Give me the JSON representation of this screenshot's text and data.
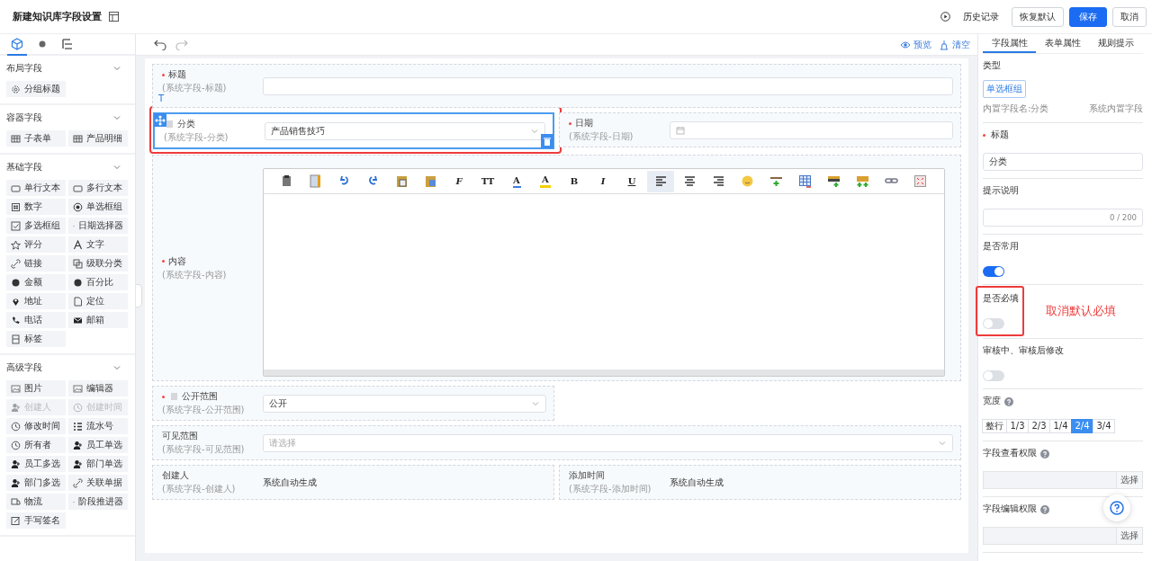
{
  "header": {
    "title": "新建知识库字段设置",
    "actions": [
      {
        "kind": "link",
        "label": "历史记录"
      },
      {
        "kind": "default",
        "label": "恢复默认"
      },
      {
        "kind": "primary",
        "label": "保存"
      },
      {
        "kind": "default",
        "label": "取消"
      }
    ]
  },
  "sidebar": {
    "tabs": [
      {
        "selected": true
      },
      {
        "selected": false
      },
      {
        "selected": false
      }
    ],
    "sections": [
      {
        "title": "布局字段",
        "expanded": true,
        "items": [
          {
            "label": "分组标题",
            "disabled": false
          }
        ]
      },
      {
        "title": "容器字段",
        "expanded": true,
        "items": [
          {
            "label": "子表单",
            "disabled": false
          },
          {
            "label": "产品明细",
            "disabled": false
          }
        ]
      },
      {
        "title": "基础字段",
        "expanded": true,
        "items": [
          {
            "label": "单行文本",
            "disabled": false
          },
          {
            "label": "多行文本",
            "disabled": false
          },
          {
            "label": "数字",
            "disabled": false
          },
          {
            "label": "单选框组",
            "disabled": false
          },
          {
            "label": "多选框组",
            "disabled": false
          },
          {
            "label": "日期选择器",
            "disabled": false
          },
          {
            "label": "评分",
            "disabled": false
          },
          {
            "label": "文字",
            "disabled": false
          },
          {
            "label": "链接",
            "disabled": false
          },
          {
            "label": "级联分类",
            "disabled": false
          },
          {
            "label": "金额",
            "disabled": false
          },
          {
            "label": "百分比",
            "disabled": false
          },
          {
            "label": "地址",
            "disabled": false
          },
          {
            "label": "定位",
            "disabled": false
          },
          {
            "label": "电话",
            "disabled": false
          },
          {
            "label": "邮箱",
            "disabled": false
          },
          {
            "label": "标签",
            "disabled": false
          }
        ]
      },
      {
        "title": "高级字段",
        "expanded": true,
        "items": [
          {
            "label": "图片",
            "disabled": false
          },
          {
            "label": "编辑器",
            "disabled": false
          },
          {
            "label": "创建人",
            "disabled": true
          },
          {
            "label": "创建时间",
            "disabled": true
          },
          {
            "label": "修改时间",
            "disabled": false
          },
          {
            "label": "流水号",
            "disabled": false
          },
          {
            "label": "所有者",
            "disabled": false
          },
          {
            "label": "员工单选",
            "disabled": false
          },
          {
            "label": "员工多选",
            "disabled": false
          },
          {
            "label": "部门单选",
            "disabled": false
          },
          {
            "label": "部门多选",
            "disabled": false
          },
          {
            "label": "关联单据",
            "disabled": false
          },
          {
            "label": "物流",
            "disabled": false
          },
          {
            "label": "阶段推进器",
            "disabled": false
          },
          {
            "label": "手写签名",
            "disabled": false
          }
        ]
      }
    ]
  },
  "canvas": {
    "actions": [
      {
        "label": "预览"
      },
      {
        "label": "清空"
      }
    ],
    "fields": [
      {
        "kind": "input",
        "label": "标题",
        "sublabel": "(系统字段-标题)",
        "required": true,
        "full": true,
        "locked": false,
        "selected": false,
        "annotated": false,
        "marker": "T"
      },
      {
        "kind": "select",
        "label": "分类",
        "sublabel": "(系统字段-分类)",
        "required": false,
        "full": false,
        "locked": true,
        "selected": true,
        "annotated": true,
        "value": "产品销售技巧"
      },
      {
        "kind": "date",
        "label": "日期",
        "sublabel": "(系统字段-日期)",
        "required": true,
        "full": false,
        "locked": false,
        "selected": false,
        "annotated": false
      },
      {
        "kind": "editor",
        "label": "内容",
        "sublabel": "(系统字段-内容)",
        "required": true,
        "full": true,
        "locked": false,
        "selected": false,
        "annotated": false,
        "toolbar": [
          {
            "kind": "icon",
            "selected": false
          },
          {
            "kind": "icon",
            "selected": false
          },
          {
            "kind": "icon",
            "selected": false
          },
          {
            "kind": "icon",
            "selected": false
          },
          {
            "kind": "icon",
            "selected": false
          },
          {
            "kind": "icon",
            "selected": false
          },
          {
            "kind": "glyph",
            "label": "F",
            "selected": false
          },
          {
            "kind": "glyph",
            "label": "TT",
            "selected": false
          },
          {
            "kind": "color",
            "label": "A",
            "color": "#3b7ddd",
            "selected": false
          },
          {
            "kind": "highlight",
            "label": "A",
            "color": "#f5d000",
            "selected": false
          },
          {
            "kind": "glyph",
            "label": "B",
            "selected": false
          },
          {
            "kind": "glyph",
            "label": "I",
            "selected": false
          },
          {
            "kind": "glyph",
            "label": "U",
            "selected": false
          },
          {
            "kind": "icon",
            "selected": true
          },
          {
            "kind": "icon",
            "selected": false
          },
          {
            "kind": "icon",
            "selected": false
          },
          {
            "kind": "icon",
            "selected": false
          },
          {
            "kind": "icon",
            "selected": false
          },
          {
            "kind": "icon",
            "selected": false
          },
          {
            "kind": "icon",
            "selected": false
          },
          {
            "kind": "icon",
            "selected": false
          },
          {
            "kind": "icon",
            "selected": false
          },
          {
            "kind": "icon",
            "selected": false
          }
        ]
      },
      {
        "kind": "select",
        "label": "公开范围",
        "sublabel": "(系统字段-公开范围)",
        "required": true,
        "full": false,
        "locked": true,
        "selected": false,
        "annotated": false,
        "value": "公开"
      },
      {
        "kind": "select",
        "label": "可见范围",
        "sublabel": "(系统字段-可见范围)",
        "required": false,
        "full": true,
        "locked": false,
        "selected": false,
        "annotated": false,
        "placeholder": "请选择"
      },
      {
        "kind": "auto",
        "label": "创建人",
        "sublabel": "(系统字段-创建人)",
        "required": false,
        "full": false,
        "locked": false,
        "selected": false,
        "annotated": false,
        "value": "系统自动生成"
      },
      {
        "kind": "auto",
        "label": "添加时间",
        "sublabel": "(系统字段-添加时间)",
        "required": false,
        "full": false,
        "locked": false,
        "selected": false,
        "annotated": false,
        "value": "系统自动生成"
      }
    ]
  },
  "panel": {
    "tabs": [
      {
        "label": "字段属性",
        "selected": true
      },
      {
        "label": "表单属性",
        "selected": false
      },
      {
        "label": "规则提示",
        "selected": false
      }
    ],
    "props": [
      {
        "kind": "type",
        "label": "类型",
        "tag": "单选框组",
        "field_name": "内置字段名:分类",
        "note": "系统内置字段"
      },
      {
        "kind": "text",
        "label": "标题",
        "required": true,
        "value": "分类"
      },
      {
        "kind": "textarea",
        "label": "提示说明",
        "counter": "0 / 200"
      },
      {
        "kind": "toggle",
        "label": "是否常用",
        "on": true
      },
      {
        "kind": "toggle",
        "label": "是否必填",
        "on": false,
        "annotation": "取消默认必填"
      },
      {
        "kind": "toggle",
        "label": "审核中、审核后修改",
        "on": false
      },
      {
        "kind": "segments",
        "label": "宽度",
        "help": true,
        "options": [
          {
            "label": "整行",
            "selected": false
          },
          {
            "label": "1/3",
            "selected": false
          },
          {
            "label": "2/3",
            "selected": false
          },
          {
            "label": "1/4",
            "selected": false
          },
          {
            "label": "2/4",
            "selected": true
          },
          {
            "label": "3/4",
            "selected": false
          }
        ]
      },
      {
        "kind": "permission",
        "label": "字段查看权限",
        "help": true,
        "button": "选择"
      },
      {
        "kind": "permission",
        "label": "字段编辑权限",
        "help": true,
        "button": "选择"
      }
    ]
  }
}
